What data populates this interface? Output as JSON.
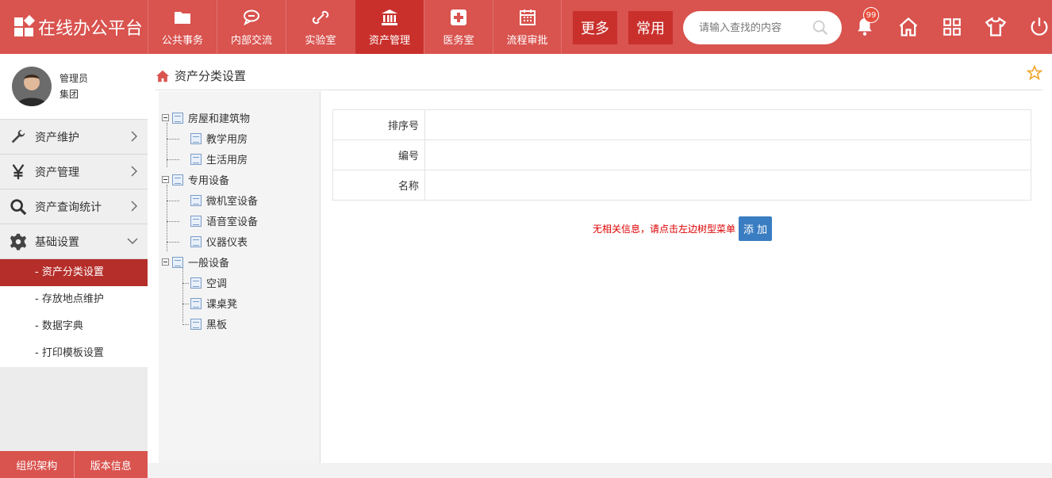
{
  "app": {
    "title": "在线办公平台"
  },
  "nav": [
    {
      "label": "公共事务",
      "icon": "folder-icon"
    },
    {
      "label": "内部交流",
      "icon": "chat-icon"
    },
    {
      "label": "实验室",
      "icon": "link-icon"
    },
    {
      "label": "资产管理",
      "icon": "bank-icon",
      "active": true
    },
    {
      "label": "医务室",
      "icon": "medical-cross-icon"
    },
    {
      "label": "流程审批",
      "icon": "calendar-icon"
    }
  ],
  "more_label": "更多",
  "common_label": "常用",
  "search": {
    "placeholder": "请输入查找的内容"
  },
  "notifications": {
    "count": "99"
  },
  "user": {
    "role": "管理员",
    "org": "集团"
  },
  "sidebar": {
    "items": [
      {
        "label": "资产维护",
        "icon": "wrench-icon"
      },
      {
        "label": "资产管理",
        "icon": "yen-icon"
      },
      {
        "label": "资产查询统计",
        "icon": "search-icon"
      },
      {
        "label": "基础设置",
        "icon": "gear-icon",
        "expanded": true
      }
    ],
    "subitems": [
      {
        "label": "- 资产分类设置",
        "active": true
      },
      {
        "label": "- 存放地点维护"
      },
      {
        "label": "- 数据字典"
      },
      {
        "label": "- 打印模板设置"
      }
    ],
    "footer": [
      "组织架构",
      "版本信息"
    ]
  },
  "breadcrumb": {
    "title": "资产分类设置"
  },
  "tree": [
    {
      "label": "房屋和建筑物",
      "level": 0
    },
    {
      "label": "教学用房",
      "level": 1
    },
    {
      "label": "生活用房",
      "level": 1
    },
    {
      "label": "专用设备",
      "level": 0
    },
    {
      "label": "微机室设备",
      "level": 1
    },
    {
      "label": "语音室设备",
      "level": 1
    },
    {
      "label": "仪器仪表",
      "level": 1
    },
    {
      "label": "一般设备",
      "level": 0
    },
    {
      "label": "空调",
      "level": 1
    },
    {
      "label": "课桌凳",
      "level": 1
    },
    {
      "label": "黑板",
      "level": 1
    }
  ],
  "form": {
    "sort_label": "排序号",
    "code_label": "编号",
    "name_label": "名称"
  },
  "message": "无相关信息，请点击左边树型菜单",
  "add_label": "添 加",
  "colors": {
    "brand": "#d9534f",
    "brand_dark": "#c9302c",
    "active_sub": "#b52e2a",
    "button_blue": "#3a7dc2"
  }
}
